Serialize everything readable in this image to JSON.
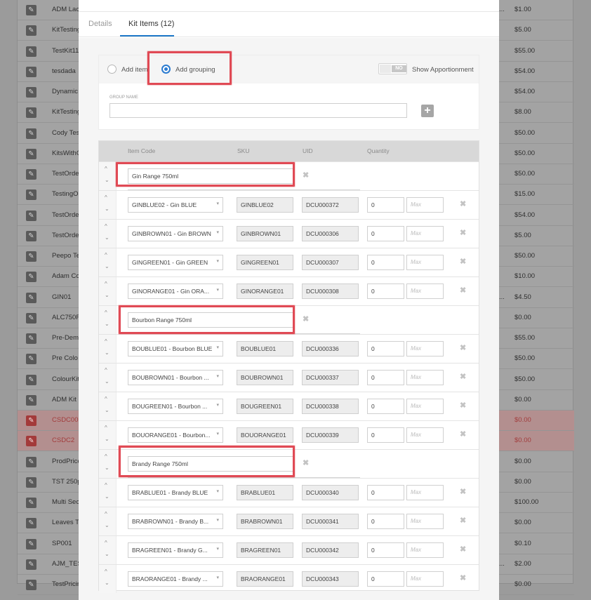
{
  "background_list": {
    "rows": [
      {
        "name": "ADM Lac",
        "mid": "...",
        "price": "$1.00",
        "error": false
      },
      {
        "name": "KitTesting",
        "mid": "",
        "price": "$5.00",
        "error": false
      },
      {
        "name": "TestKit11",
        "mid": "",
        "price": "$55.00",
        "error": false
      },
      {
        "name": "tesdada",
        "mid": "",
        "price": "$54.00",
        "error": false
      },
      {
        "name": "Dynamic",
        "mid": "",
        "price": "$54.00",
        "error": false
      },
      {
        "name": "KitTesting",
        "mid": "",
        "price": "$8.00",
        "error": false
      },
      {
        "name": "Cody Tes",
        "mid": "",
        "price": "$50.00",
        "error": false
      },
      {
        "name": "KitsWithO",
        "mid": "",
        "price": "$50.00",
        "error": false
      },
      {
        "name": "TestOrde",
        "mid": "",
        "price": "$50.00",
        "error": false
      },
      {
        "name": "TestingO",
        "mid": "",
        "price": "$15.00",
        "error": false
      },
      {
        "name": "TestOrde",
        "mid": "",
        "price": "$54.00",
        "error": false
      },
      {
        "name": "TestOrde",
        "mid": "",
        "price": "$5.00",
        "error": false
      },
      {
        "name": "Peepo Te",
        "mid": "",
        "price": "$50.00",
        "error": false
      },
      {
        "name": "Adam Co",
        "mid": "",
        "price": "$10.00",
        "error": false
      },
      {
        "name": "GIN01",
        "mid": "...",
        "price": "$4.50",
        "error": false
      },
      {
        "name": "ALC750R",
        "mid": "",
        "price": "$0.00",
        "error": false
      },
      {
        "name": "Pre-Dem",
        "mid": "",
        "price": "$55.00",
        "error": false
      },
      {
        "name": "Pre Colo",
        "mid": "",
        "price": "$50.00",
        "error": false
      },
      {
        "name": "ColourKit",
        "mid": "",
        "price": "$50.00",
        "error": false
      },
      {
        "name": "ADM Kit",
        "mid": "",
        "price": "$0.00",
        "error": false
      },
      {
        "name": "CSDC00",
        "mid": "",
        "price": "$0.00",
        "error": true
      },
      {
        "name": "CSDC2",
        "mid": "",
        "price": "$0.00",
        "error": true
      },
      {
        "name": "ProdPrice",
        "mid": "",
        "price": "$0.00",
        "error": false
      },
      {
        "name": "TST 250p",
        "mid": "",
        "price": "$0.00",
        "error": false
      },
      {
        "name": "Multi Sec",
        "mid": "",
        "price": "$100.00",
        "error": false
      },
      {
        "name": "Leaves T",
        "mid": "",
        "price": "$0.00",
        "error": false
      },
      {
        "name": "SP001",
        "mid": "",
        "price": "$0.10",
        "error": false
      },
      {
        "name": "AJM_TES",
        "mid": "...",
        "price": "$2.00",
        "error": false
      },
      {
        "name": "TestPricin",
        "mid": "",
        "price": "$0.00",
        "error": false
      }
    ]
  },
  "tabs": [
    {
      "label": "Details",
      "active": false
    },
    {
      "label": "Kit Items (12)",
      "active": true
    }
  ],
  "grouping": {
    "add_item_label": "Add item",
    "add_grouping_label": "Add grouping",
    "selected": "add_grouping",
    "toggle_state": "NO",
    "toggle_label": "Show Apportionment",
    "group_name_label": "GROUP NAME",
    "group_name_value": ""
  },
  "table": {
    "headers": {
      "item_code": "Item Code",
      "sku": "SKU",
      "uid": "UID",
      "quantity": "Quantity"
    },
    "max_placeholder": "Max",
    "rows": [
      {
        "type": "group",
        "name": "Gin Range 750ml"
      },
      {
        "type": "item",
        "code": "GINBLUE02 - Gin BLUE",
        "sku": "GINBLUE02",
        "uid": "DCU000372",
        "qty": "0"
      },
      {
        "type": "item",
        "code": "GINBROWN01 - Gin BROWN",
        "sku": "GINBROWN01",
        "uid": "DCU000306",
        "qty": "0"
      },
      {
        "type": "item",
        "code": "GINGREEN01 - Gin GREEN",
        "sku": "GINGREEN01",
        "uid": "DCU000307",
        "qty": "0"
      },
      {
        "type": "item",
        "code": "GINORANGE01 - Gin ORA...",
        "sku": "GINORANGE01",
        "uid": "DCU000308",
        "qty": "0"
      },
      {
        "type": "group",
        "name": "Bourbon Range 750ml"
      },
      {
        "type": "item",
        "code": "BOUBLUE01 - Bourbon BLUE",
        "sku": "BOUBLUE01",
        "uid": "DCU000336",
        "qty": "0"
      },
      {
        "type": "item",
        "code": "BOUBROWN01 - Bourbon ...",
        "sku": "BOUBROWN01",
        "uid": "DCU000337",
        "qty": "0"
      },
      {
        "type": "item",
        "code": "BOUGREEN01 - Bourbon ...",
        "sku": "BOUGREEN01",
        "uid": "DCU000338",
        "qty": "0"
      },
      {
        "type": "item",
        "code": "BOUORANGE01 - Bourbon...",
        "sku": "BOUORANGE01",
        "uid": "DCU000339",
        "qty": "0"
      },
      {
        "type": "group",
        "name": "Brandy Range 750ml"
      },
      {
        "type": "item",
        "code": "BRABLUE01 - Brandy BLUE",
        "sku": "BRABLUE01",
        "uid": "DCU000340",
        "qty": "0"
      },
      {
        "type": "item",
        "code": "BRABROWN01 - Brandy B...",
        "sku": "BRABROWN01",
        "uid": "DCU000341",
        "qty": "0"
      },
      {
        "type": "item",
        "code": "BRAGREEN01 - Brandy G...",
        "sku": "BRAGREEN01",
        "uid": "DCU000342",
        "qty": "0"
      },
      {
        "type": "item",
        "code": "BRAORANGE01 - Brandy ...",
        "sku": "BRAORANGE01",
        "uid": "DCU000343",
        "qty": "0"
      }
    ]
  },
  "icons": {
    "edit": "pencil-icon",
    "add_group": "plus-icon",
    "remove": "close-icon",
    "move_up": "chevron-up-icon",
    "move_down": "chevron-down-icon",
    "dropdown": "caret-down-icon"
  },
  "colors": {
    "accent": "#1f79c9",
    "highlight": "#e04a55",
    "error_row": "#b38f8f"
  }
}
